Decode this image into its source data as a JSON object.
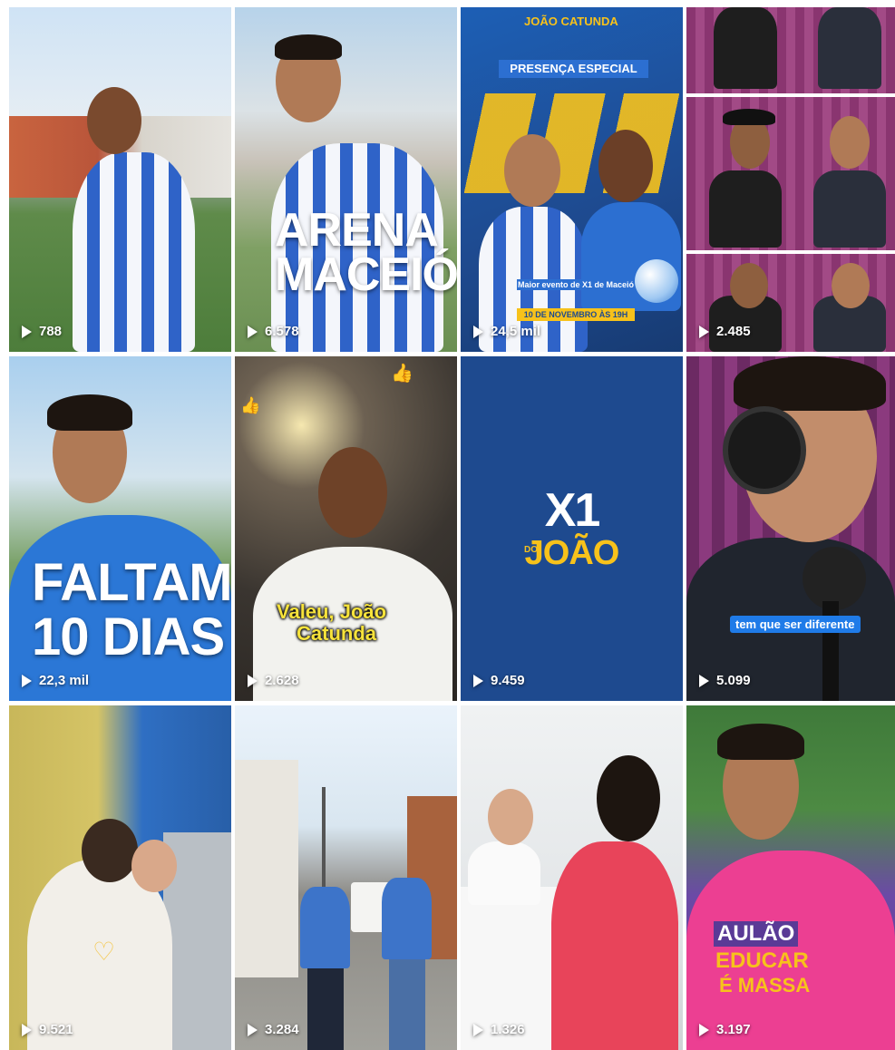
{
  "tiles": [
    {
      "views": "788",
      "icon": "play-icon"
    },
    {
      "views": "6.578",
      "overlay": "ARENA MACEIÓ",
      "icon": "play-icon"
    },
    {
      "views": "24,5 mil",
      "header": "PRESENÇA ESPECIAL",
      "brand": "JOÃO CATUNDA",
      "event": "Maior evento de X1 de Maceió",
      "date": "10 DE NOVEMBRO ÀS 19H",
      "icon": "play-icon"
    },
    {
      "views": "2.485",
      "icon": "play-icon"
    },
    {
      "views": "22,3 mil",
      "overlay_line1": "FALTAM",
      "overlay_line2": "10 DIAS",
      "icon": "play-icon"
    },
    {
      "views": "2.628",
      "caption_line1": "Valeu, João",
      "caption_line2": "Catunda",
      "icon": "play-icon"
    },
    {
      "views": "9.459",
      "logo_main": "X1",
      "logo_small": "DO",
      "logo_name": "JOÃO",
      "icon": "play-icon"
    },
    {
      "views": "5.099",
      "caption": "tem que ser diferente",
      "icon": "play-icon"
    },
    {
      "views": "9.521",
      "icon": "play-icon"
    },
    {
      "views": "3.284",
      "icon": "play-icon"
    },
    {
      "views": "1.326",
      "icon": "play-icon"
    },
    {
      "views": "3.197",
      "shirt_line1": "AULÃO",
      "shirt_line2": "EDUCAR",
      "shirt_line3": "É MASSA",
      "icon": "play-icon"
    }
  ],
  "colors": {
    "brand_blue": "#1e4a8f",
    "stripe_blue": "#2f63c8",
    "yellow": "#f7c21b",
    "pink": "#e83f8a",
    "caption_blue": "#1f7be8"
  }
}
